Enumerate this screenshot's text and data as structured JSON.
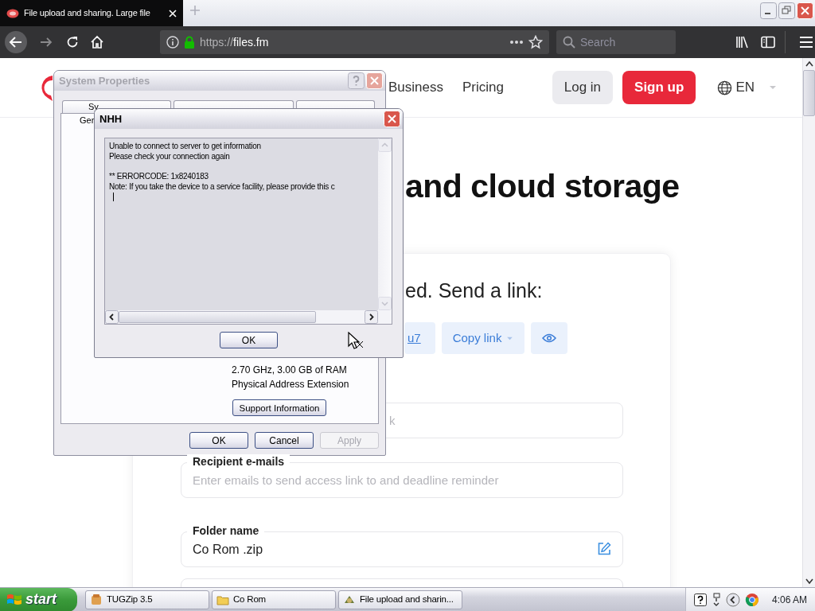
{
  "browser": {
    "tab": {
      "title": "File upload and sharing. Large file",
      "selected": true
    },
    "address": {
      "scheme": "https://",
      "host": "files.fm"
    },
    "search": {
      "placeholder": "Search"
    }
  },
  "site": {
    "nav": [
      {
        "label": "Business"
      },
      {
        "label": "Pricing"
      }
    ],
    "login": "Log in",
    "signup": "Sign up",
    "language": "EN",
    "heading": "and cloud storage",
    "share_title": "ed. Send a link:",
    "link_tail": "u7",
    "copy_link": "Copy link",
    "fields": [
      {
        "kind": "plain",
        "placeholder": "k"
      },
      {
        "kind": "labeled",
        "label": "Recipient e-mails",
        "placeholder": "Enter emails to send access link to and deadline reminder"
      },
      {
        "kind": "editable",
        "label": "Folder name",
        "value": "Co Rom .zip"
      }
    ]
  },
  "system_properties": {
    "title": "System Properties",
    "tabs": [
      {
        "label": "Sy",
        "selected": false
      },
      {
        "label": "Ger",
        "selected": true
      }
    ],
    "info": [
      "2.70 GHz, 3.00 GB of RAM",
      "Physical Address Extension"
    ],
    "support_button": "Support Information",
    "buttons": [
      {
        "label": "OK",
        "disabled": false
      },
      {
        "label": "Cancel",
        "disabled": false
      },
      {
        "label": "Apply",
        "disabled": true
      }
    ]
  },
  "dialog": {
    "title": "NHH",
    "message": "Unable to connect to server to get information\nPlease check your connection again\n\n** ERRORCODE: 1x8240183\nNote: If you take the device to a service facility, please provide this c",
    "button": "OK"
  },
  "taskbar": {
    "start": "start",
    "tasks": [
      {
        "label": "TUGZip 3.5",
        "selected": false
      },
      {
        "label": "Co Rom",
        "selected": false
      },
      {
        "label": "File upload and sharin...",
        "selected": false
      }
    ],
    "clock": "4:06 AM"
  }
}
